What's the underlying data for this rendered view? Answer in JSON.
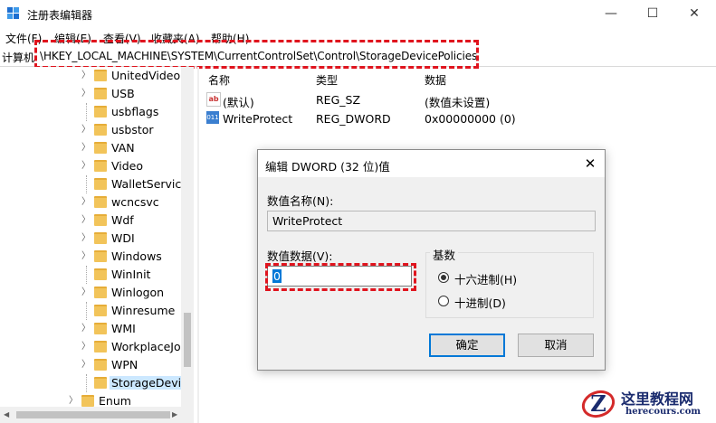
{
  "window": {
    "title": "注册表编辑器",
    "controls": {
      "minimize": "—",
      "maximize": "☐",
      "close": "✕"
    }
  },
  "menu": [
    "文件(F)",
    "编辑(E)",
    "查看(V)",
    "收藏夹(A)",
    "帮助(H)"
  ],
  "address": {
    "label": "计算机",
    "path": "\\HKEY_LOCAL_MACHINE\\SYSTEM\\CurrentControlSet\\Control\\StorageDevicePolicies"
  },
  "tree": {
    "items": [
      "UnitedVideo",
      "USB",
      "usbflags",
      "usbstor",
      "VAN",
      "Video",
      "WalletService",
      "wcncsvc",
      "Wdf",
      "WDI",
      "Windows",
      "WinInit",
      "Winlogon",
      "Winresume",
      "WMI",
      "WorkplaceJo",
      "WPN",
      "StorageDevic",
      "Enum"
    ],
    "selected": "StorageDevic"
  },
  "list": {
    "headers": {
      "name": "名称",
      "type": "类型",
      "data": "数据"
    },
    "rows": [
      {
        "icon": "string-value-icon",
        "icon_text": "ab",
        "name": "(默认)",
        "type": "REG_SZ",
        "data": "(数值未设置)"
      },
      {
        "icon": "binary-value-icon",
        "icon_text": "011",
        "name": "WriteProtect",
        "type": "REG_DWORD",
        "data": "0x00000000 (0)"
      }
    ]
  },
  "dialog": {
    "title": "编辑 DWORD (32 位)值",
    "close": "✕",
    "name_label": "数值名称(N):",
    "name_value": "WriteProtect",
    "data_label": "数值数据(V):",
    "data_value": "0",
    "base_label": "基数",
    "base_options": [
      {
        "label": "十六进制(H)",
        "checked": true
      },
      {
        "label": "十进制(D)",
        "checked": false
      }
    ],
    "ok": "确定",
    "cancel": "取消"
  },
  "watermark": {
    "brand": "这里教程网",
    "url": "herecours.com"
  },
  "colors": {
    "highlight_dash": "#e0141e",
    "selection": "#0078d7",
    "folder": "#f2c45a"
  }
}
